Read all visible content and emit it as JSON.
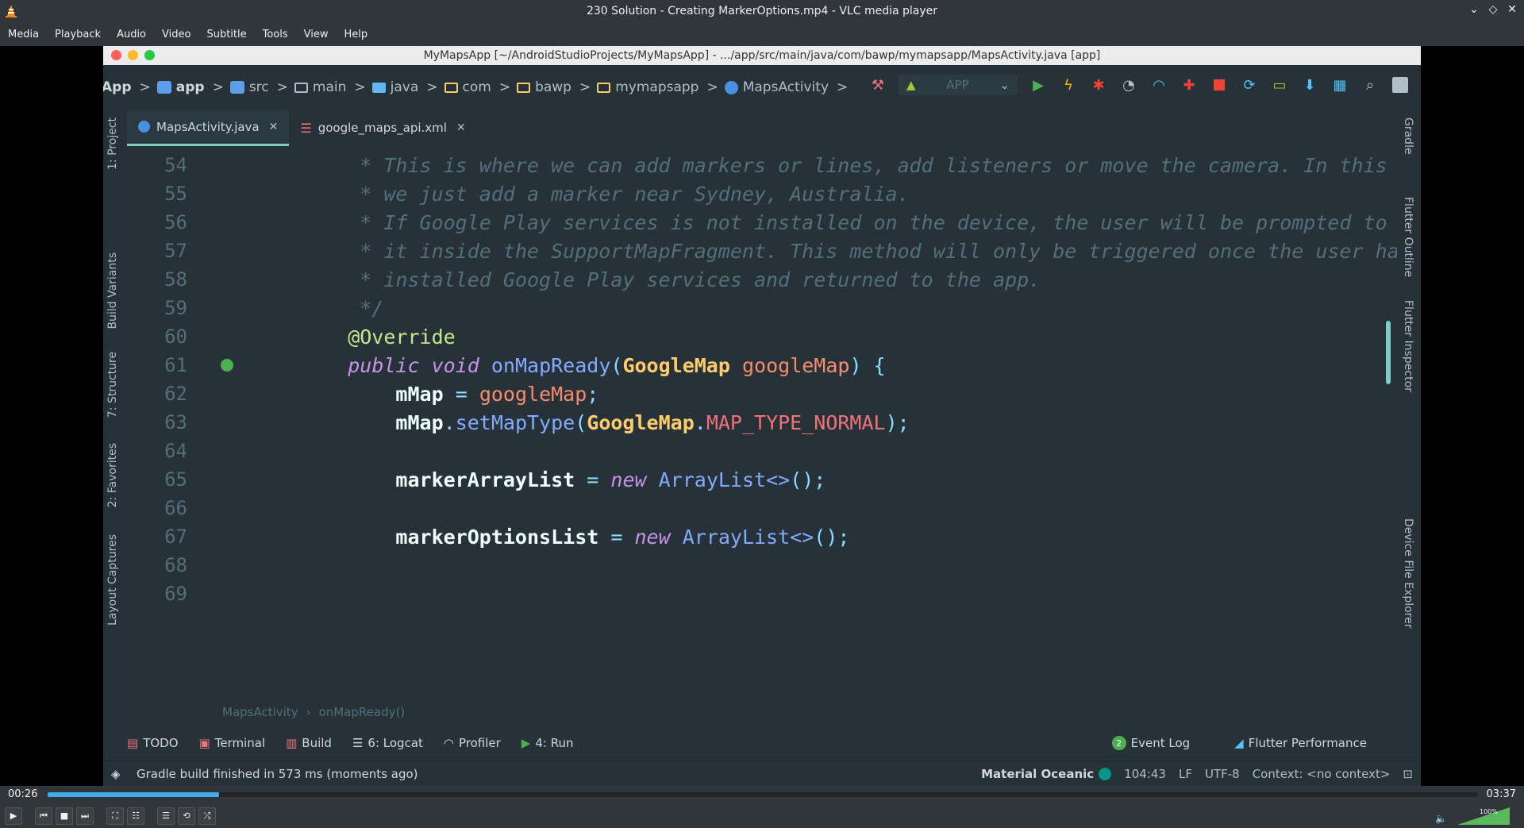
{
  "vlc": {
    "title": "230 Solution - Creating MarkerOptions.mp4 - VLC media player",
    "menu": [
      "Media",
      "Playback",
      "Audio",
      "Video",
      "Subtitle",
      "Tools",
      "View",
      "Help"
    ],
    "time_elapsed": "00:26",
    "time_total": "03:37",
    "progress": 0.12,
    "volume_label": "100%"
  },
  "ide": {
    "window_title": "MyMapsApp [~/AndroidStudioProjects/MyMapsApp] - .../app/src/main/java/com/bawp/mymapsapp/MapsActivity.java [app]",
    "breadcrumbs": [
      "App",
      "app",
      "src",
      "main",
      "java",
      "com",
      "bawp",
      "mymapsapp",
      "MapsActivity"
    ],
    "run_config": "APP",
    "tabs": [
      {
        "label": "MapsActivity.java",
        "active": true
      },
      {
        "label": "google_maps_api.xml",
        "active": false
      }
    ],
    "left_tools": [
      "1: Project",
      "Build Variants",
      "7: Structure",
      "2: Favorites",
      "Layout Captures"
    ],
    "right_tools": [
      "Gradle",
      "Flutter Outline",
      "Flutter Inspector",
      "Device File Explorer"
    ],
    "lines": [
      {
        "n": "54",
        "text": "     * This is where we can add markers or lines, add listeners or move the camera. In this ca"
      },
      {
        "n": "55",
        "text": "     * we just add a marker near Sydney, Australia."
      },
      {
        "n": "56",
        "text": "     * If Google Play services is not installed on the device, the user will be prompted to in"
      },
      {
        "n": "57",
        "text": "     * it inside the SupportMapFragment. This method will only be triggered once the user has"
      },
      {
        "n": "58",
        "text": "     * installed Google Play services and returned to the app."
      },
      {
        "n": "59",
        "text": "     */"
      },
      {
        "n": "60",
        "text": "    @Override"
      },
      {
        "n": "61",
        "text": ""
      },
      {
        "n": "62",
        "text": ""
      },
      {
        "n": "63",
        "text": ""
      },
      {
        "n": "64",
        "text": ""
      },
      {
        "n": "65",
        "text": ""
      },
      {
        "n": "66",
        "text": ""
      },
      {
        "n": "67",
        "text": ""
      },
      {
        "n": "68",
        "text": ""
      },
      {
        "n": "69",
        "text": ""
      }
    ],
    "code": {
      "l61_public": "public",
      "l61_void": "void",
      "l61_fn": "onMapReady",
      "l61_type": "GoogleMap",
      "l61_param": "googleMap",
      "l62_field": "mMap",
      "l62_val": "googleMap",
      "l63_field": "mMap",
      "l63_fn": "setMapType",
      "l63_type": "GoogleMap",
      "l63_const": "MAP_TYPE_NORMAL",
      "l65_field": "markerArrayList",
      "l65_new": "new",
      "l65_type": "ArrayList<>",
      "l67_field": "markerOptionsList",
      "l67_new": "new",
      "l67_type": "ArrayList<>"
    },
    "editor_breadcrumb": [
      "MapsActivity",
      "onMapReady()"
    ],
    "bottom_tools": [
      "TODO",
      "Terminal",
      "Build",
      "6: Logcat",
      "Profiler",
      "4: Run"
    ],
    "bottom_tools_right": [
      "Event Log",
      "Flutter Performance"
    ],
    "event_log_count": "2",
    "status_message": "Gradle build finished in 573 ms (moments ago)",
    "status_theme": "Material Oceanic",
    "status_position": "104:43",
    "status_line_sep": "LF",
    "status_encoding": "UTF-8",
    "status_context": "Context: <no context>"
  },
  "colors": {
    "bg": "#263238",
    "accent": "#80cbc4",
    "vlc_accent": "#3daee9"
  }
}
